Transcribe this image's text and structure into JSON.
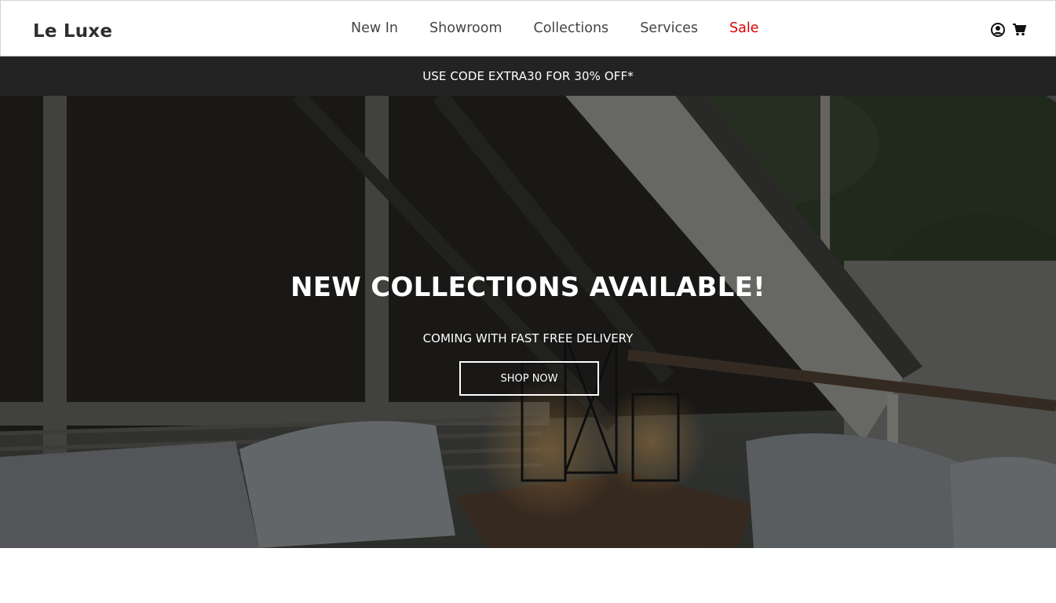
{
  "brand": {
    "name": "Le Luxe"
  },
  "nav": {
    "items": [
      {
        "label": "New In"
      },
      {
        "label": "Showroom"
      },
      {
        "label": "Collections"
      },
      {
        "label": "Services"
      },
      {
        "label": "Sale"
      }
    ],
    "icons": [
      "user-icon",
      "cart-icon"
    ]
  },
  "promo": {
    "text": "USE CODE EXTRA30 FOR 30% OFF*"
  },
  "hero": {
    "title": "NEW COLLECTIONS AVAILABLE!",
    "subtitle": "COMING WITH FAST FREE DELIVERY",
    "cta_label": "SHOP NOW"
  },
  "colors": {
    "sale": "#e00000",
    "promo_bg": "#232323",
    "text_dark": "#333333"
  }
}
